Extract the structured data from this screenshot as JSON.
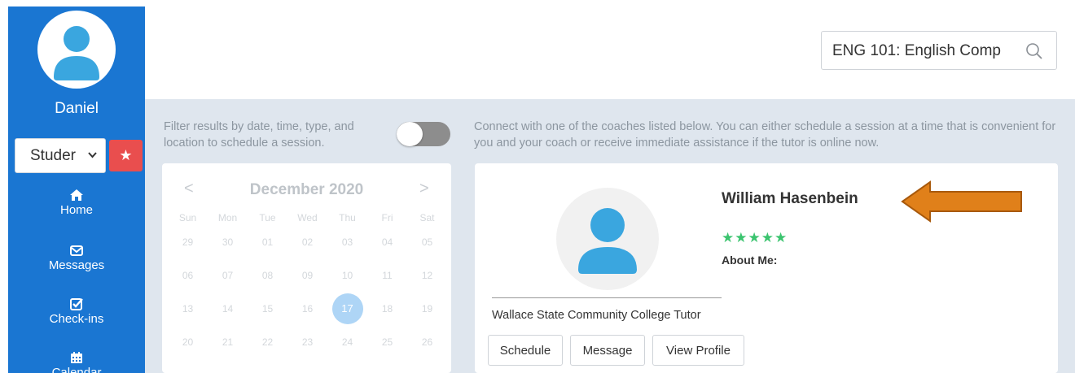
{
  "sidebar": {
    "user_name": "Daniel",
    "role_select_value": "Studer",
    "nav": [
      {
        "label": "Home",
        "icon": "home-icon"
      },
      {
        "label": "Messages",
        "icon": "envelope-icon"
      },
      {
        "label": "Check-ins",
        "icon": "check-square-icon"
      },
      {
        "label": "Calendar",
        "icon": "calendar-icon"
      }
    ]
  },
  "header": {
    "search_value": "ENG 101: English Comp"
  },
  "filter": {
    "text": "Filter results by date, time, type, and location to schedule a session."
  },
  "connect_text": "Connect with one of the coaches listed below. You can either schedule a session at a time that is convenient for you and your coach or receive immediate assistance if the tutor is online now.",
  "calendar": {
    "prev": "<",
    "next": ">",
    "title": "December 2020",
    "weekdays": [
      "Sun",
      "Mon",
      "Tue",
      "Wed",
      "Thu",
      "Fri",
      "Sat"
    ],
    "weeks": [
      [
        "29",
        "30",
        "01",
        "02",
        "03",
        "04",
        "05"
      ],
      [
        "06",
        "07",
        "08",
        "09",
        "10",
        "11",
        "12"
      ],
      [
        "13",
        "14",
        "15",
        "16",
        "17",
        "18",
        "19"
      ],
      [
        "20",
        "21",
        "22",
        "23",
        "24",
        "25",
        "26"
      ]
    ],
    "highlighted": "17"
  },
  "coach": {
    "name": "William Hasenbein",
    "rating_stars": "★★★★★",
    "about_label": "About Me:",
    "org": "Wallace State Community College Tutor",
    "buttons": {
      "schedule": "Schedule",
      "message": "Message",
      "profile": "View Profile"
    }
  },
  "colors": {
    "sidebar": "#1a76d2",
    "favorite": "#e94e4e",
    "stars": "#3bc46f",
    "arrow": "#e0801a",
    "avatar": "#3aa6df"
  }
}
